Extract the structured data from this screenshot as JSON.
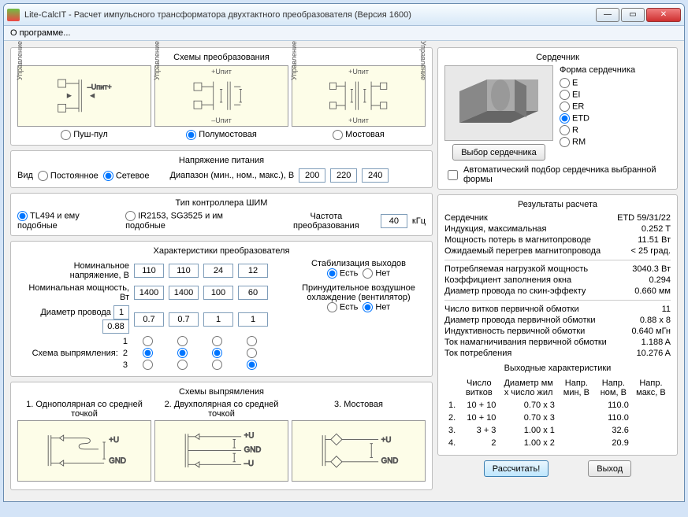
{
  "window": {
    "title": "Lite-CalcIT - Расчет импульсного трансформатора двухтактного преобразователя (Версия 1600)",
    "menu_about": "О программе..."
  },
  "schemes": {
    "title": "Схемы преобразования",
    "pushpull": "Пуш-пул",
    "halfbridge": "Полумостовая",
    "bridge": "Мостовая",
    "upit_plus": "+Uпит",
    "upit_minus": "–Uпит",
    "control": "Управление"
  },
  "supply": {
    "title": "Напряжение питания",
    "kind": "Вид",
    "dc": "Постоянное",
    "ac": "Сетевое",
    "range_label": "Диапазон (мин., ном., макс.), В",
    "min": "200",
    "nom": "220",
    "max": "240"
  },
  "pwm": {
    "title": "Тип контроллера ШИМ",
    "opt1": "TL494 и ему подобные",
    "opt2": "IR2153, SG3525 и им подобные",
    "freq_label": "Частота преобразования",
    "freq": "40",
    "freq_unit": "кГц"
  },
  "char": {
    "title": "Характеристики преобразователя",
    "nom_v": "Номинальное напряжение, В",
    "nom_p": "Номинальная мощность, Вт",
    "wire_d": "Диаметр провода",
    "v": [
      "110",
      "110",
      "24",
      "12"
    ],
    "p": [
      "1400",
      "1400",
      "100",
      "60"
    ],
    "primary_wire": "0.88",
    "primary_wire_n": "1",
    "d": [
      "0.7",
      "0.7",
      "1",
      "1"
    ],
    "stab_title": "Стабилизация выходов",
    "yes": "Есть",
    "no": "Нет",
    "cooling_title": "Принудительное воздушное охлаждение (вентилятор)",
    "rect_scheme": "Схема выпрямления:"
  },
  "rect": {
    "title": "Схемы выпрямления",
    "s1": "1. Однополярная со средней точкой",
    "s2": "2. Двухполярная со средней точкой",
    "s3": "3. Мостовая",
    "u_plus": "+U",
    "gnd": "GND",
    "u_minus": "–U"
  },
  "core": {
    "title": "Сердечник",
    "shape_title": "Форма сердечника",
    "shapes": [
      "E",
      "EI",
      "ER",
      "ETD",
      "R",
      "RM"
    ],
    "choose_btn": "Выбор сердечника",
    "auto": "Автоматический подбор сердечника выбранной формы"
  },
  "results": {
    "title": "Результаты расчета",
    "r": [
      [
        "Сердечник",
        "ETD 59/31/22"
      ],
      [
        "Индукция, максимальная",
        "0.252 T"
      ],
      [
        "Мощность потерь в магнитопроводе",
        "11.51 Вт"
      ],
      [
        "Ожидаемый перегрев магнитопровода",
        "< 25 град."
      ]
    ],
    "r2": [
      [
        "Потребляемая нагрузкой мощность",
        "3040.3 Вт"
      ],
      [
        "Коэффициент заполнения окна",
        "0.294"
      ],
      [
        "Диаметр провода по скин-эффекту",
        "0.660 мм"
      ]
    ],
    "r3": [
      [
        "Число витков первичной обмотки",
        "11"
      ],
      [
        "Диаметр провода первичной обмотки",
        "0.88 x 8"
      ],
      [
        "Индуктивность первичной обмотки",
        "0.640 мГн"
      ],
      [
        "Ток намагничивания первичной обмотки",
        "1.188 A"
      ],
      [
        "Ток потребления",
        "10.276 A"
      ]
    ],
    "out_title": "Выходные характеристики",
    "out_headers": [
      "",
      "Число витков",
      "Диаметр мм x число жил",
      "Напр. мин, В",
      "Напр. ном, В",
      "Напр. макс, В"
    ],
    "out_rows": [
      [
        "1.",
        "10 + 10",
        "0.70 x 3",
        "",
        "110.0",
        ""
      ],
      [
        "2.",
        "10 + 10",
        "0.70 x 3",
        "",
        "110.0",
        ""
      ],
      [
        "3.",
        "3 + 3",
        "1.00 x 1",
        "",
        "32.6",
        ""
      ],
      [
        "4.",
        "2",
        "1.00 x 2",
        "",
        "20.9",
        ""
      ]
    ]
  },
  "buttons": {
    "calc": "Рассчитать!",
    "exit": "Выход"
  }
}
